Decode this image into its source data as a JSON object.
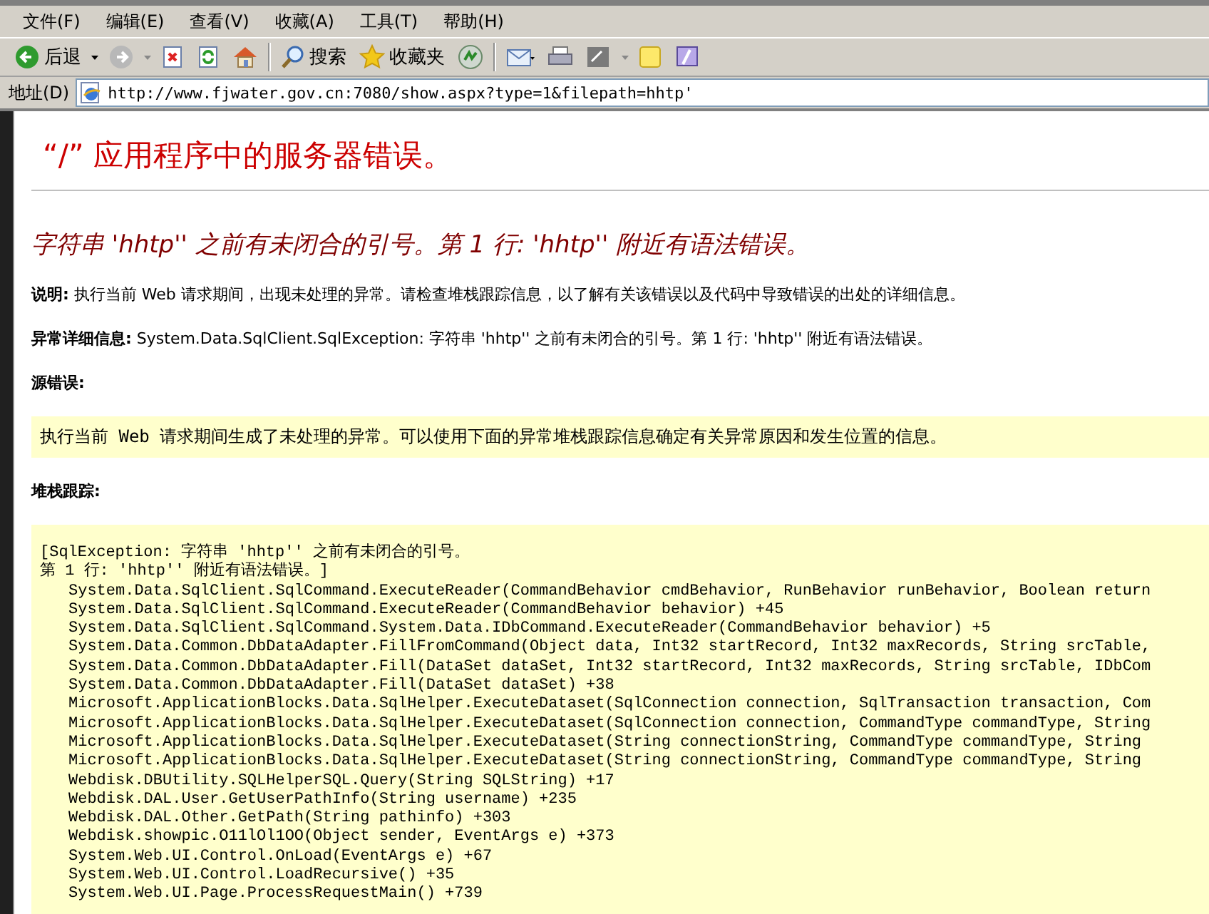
{
  "menu_bar": [
    "文件(F)",
    "编辑(E)",
    "查看(V)",
    "收藏(A)",
    "工具(T)",
    "帮助(H)"
  ],
  "toolbar": {
    "back_label": "后退",
    "search_label": "搜索",
    "favorites_label": "收藏夹"
  },
  "address_bar": {
    "label": "地址(D)",
    "url": "http://www.fjwater.gov.cn:7080/show.aspx?type=1&filepath=hhtp'"
  },
  "page": {
    "title": "“/” 应用程序中的服务器错误。",
    "error_heading": "字符串 'hhtp'' 之前有未闭合的引号。第 1 行: 'hhtp'' 附近有语法错误。",
    "description": "**说明:** 执行当前 Web 请求期间，出现未处理的异常。请检查堆栈跟踪信息，以了解有关该错误以及代码中导致错误的出处的详细信息。",
    "exception_details": "**异常详细信息:** System.Data.SqlClient.SqlException: 字符串 'hhtp'' 之前有未闭合的引号。第 1 行: 'hhtp'' 附近有语法错误。",
    "source_error": {
      "label": "源错误:",
      "text": "执行当前 Web 请求期间生成了未处理的异常。可以使用下面的异常堆栈跟踪信息确定有关异常原因和发生位置的信息。"
    },
    "stack_trace": {
      "label": "堆栈跟踪:",
      "header_lines": [
        "[SqlException: 字符串 'hhtp'' 之前有未闭合的引号。",
        "第 1 行: 'hhtp'' 附近有语法错误。]"
      ],
      "frames": [
        "System.Data.SqlClient.SqlCommand.ExecuteReader(CommandBehavior cmdBehavior, RunBehavior runBehavior, Boolean return",
        "System.Data.SqlClient.SqlCommand.ExecuteReader(CommandBehavior behavior) +45",
        "System.Data.SqlClient.SqlCommand.System.Data.IDbCommand.ExecuteReader(CommandBehavior behavior) +5",
        "System.Data.Common.DbDataAdapter.FillFromCommand(Object data, Int32 startRecord, Int32 maxRecords, String srcTable,",
        "System.Data.Common.DbDataAdapter.Fill(DataSet dataSet, Int32 startRecord, Int32 maxRecords, String srcTable, IDbCom",
        "System.Data.Common.DbDataAdapter.Fill(DataSet dataSet) +38",
        "Microsoft.ApplicationBlocks.Data.SqlHelper.ExecuteDataset(SqlConnection connection, SqlTransaction transaction, Com",
        "Microsoft.ApplicationBlocks.Data.SqlHelper.ExecuteDataset(SqlConnection connection, CommandType commandType, String",
        "Microsoft.ApplicationBlocks.Data.SqlHelper.ExecuteDataset(String connectionString, CommandType commandType, String",
        "Microsoft.ApplicationBlocks.Data.SqlHelper.ExecuteDataset(String connectionString, CommandType commandType, String",
        "Webdisk.DBUtility.SQLHelperSQL.Query(String SQLString) +17",
        "Webdisk.DAL.User.GetUserPathInfo(String username) +235",
        "Webdisk.DAL.Other.GetPath(String pathinfo) +303",
        "Webdisk.showpic.O11lOl1OO(Object sender, EventArgs e) +373",
        "System.Web.UI.Control.OnLoad(EventArgs e) +67",
        "System.Web.UI.Control.LoadRecursive() +35",
        "System.Web.UI.Page.ProcessRequestMain() +739"
      ]
    }
  }
}
